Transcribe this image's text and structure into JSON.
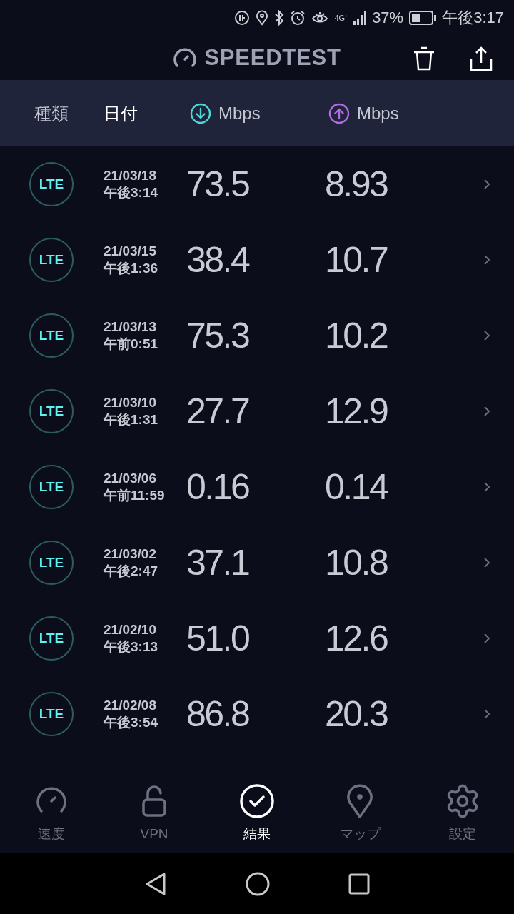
{
  "status_bar": {
    "network": "4G⁺",
    "battery": "37%",
    "time": "午後3:17"
  },
  "app_bar": {
    "title": "SPEEDTEST"
  },
  "columns": [
    {
      "label": "種類",
      "selected": false,
      "kind": "text"
    },
    {
      "label": "日付",
      "selected": true,
      "kind": "text"
    },
    {
      "label": "Mbps",
      "selected": false,
      "kind": "download"
    },
    {
      "label": "Mbps",
      "selected": false,
      "kind": "upload"
    }
  ],
  "results": [
    {
      "type": "LTE",
      "date": "21/03/18",
      "time": "午後3:14",
      "download": "73.5",
      "upload": "8.93"
    },
    {
      "type": "LTE",
      "date": "21/03/15",
      "time": "午後1:36",
      "download": "38.4",
      "upload": "10.7"
    },
    {
      "type": "LTE",
      "date": "21/03/13",
      "time": "午前0:51",
      "download": "75.3",
      "upload": "10.2"
    },
    {
      "type": "LTE",
      "date": "21/03/10",
      "time": "午後1:31",
      "download": "27.7",
      "upload": "12.9"
    },
    {
      "type": "LTE",
      "date": "21/03/06",
      "time": "午前11:59",
      "download": "0.16",
      "upload": "0.14"
    },
    {
      "type": "LTE",
      "date": "21/03/02",
      "time": "午後2:47",
      "download": "37.1",
      "upload": "10.8"
    },
    {
      "type": "LTE",
      "date": "21/02/10",
      "time": "午後3:13",
      "download": "51.0",
      "upload": "12.6"
    },
    {
      "type": "LTE",
      "date": "21/02/08",
      "time": "午後3:54",
      "download": "86.8",
      "upload": "20.3"
    }
  ],
  "bottom_nav": [
    {
      "label": "速度",
      "kind": "speed",
      "selected": false
    },
    {
      "label": "VPN",
      "kind": "vpn",
      "selected": false
    },
    {
      "label": "結果",
      "kind": "results",
      "selected": true
    },
    {
      "label": "マップ",
      "kind": "map",
      "selected": false
    },
    {
      "label": "設定",
      "kind": "settings",
      "selected": false
    }
  ]
}
